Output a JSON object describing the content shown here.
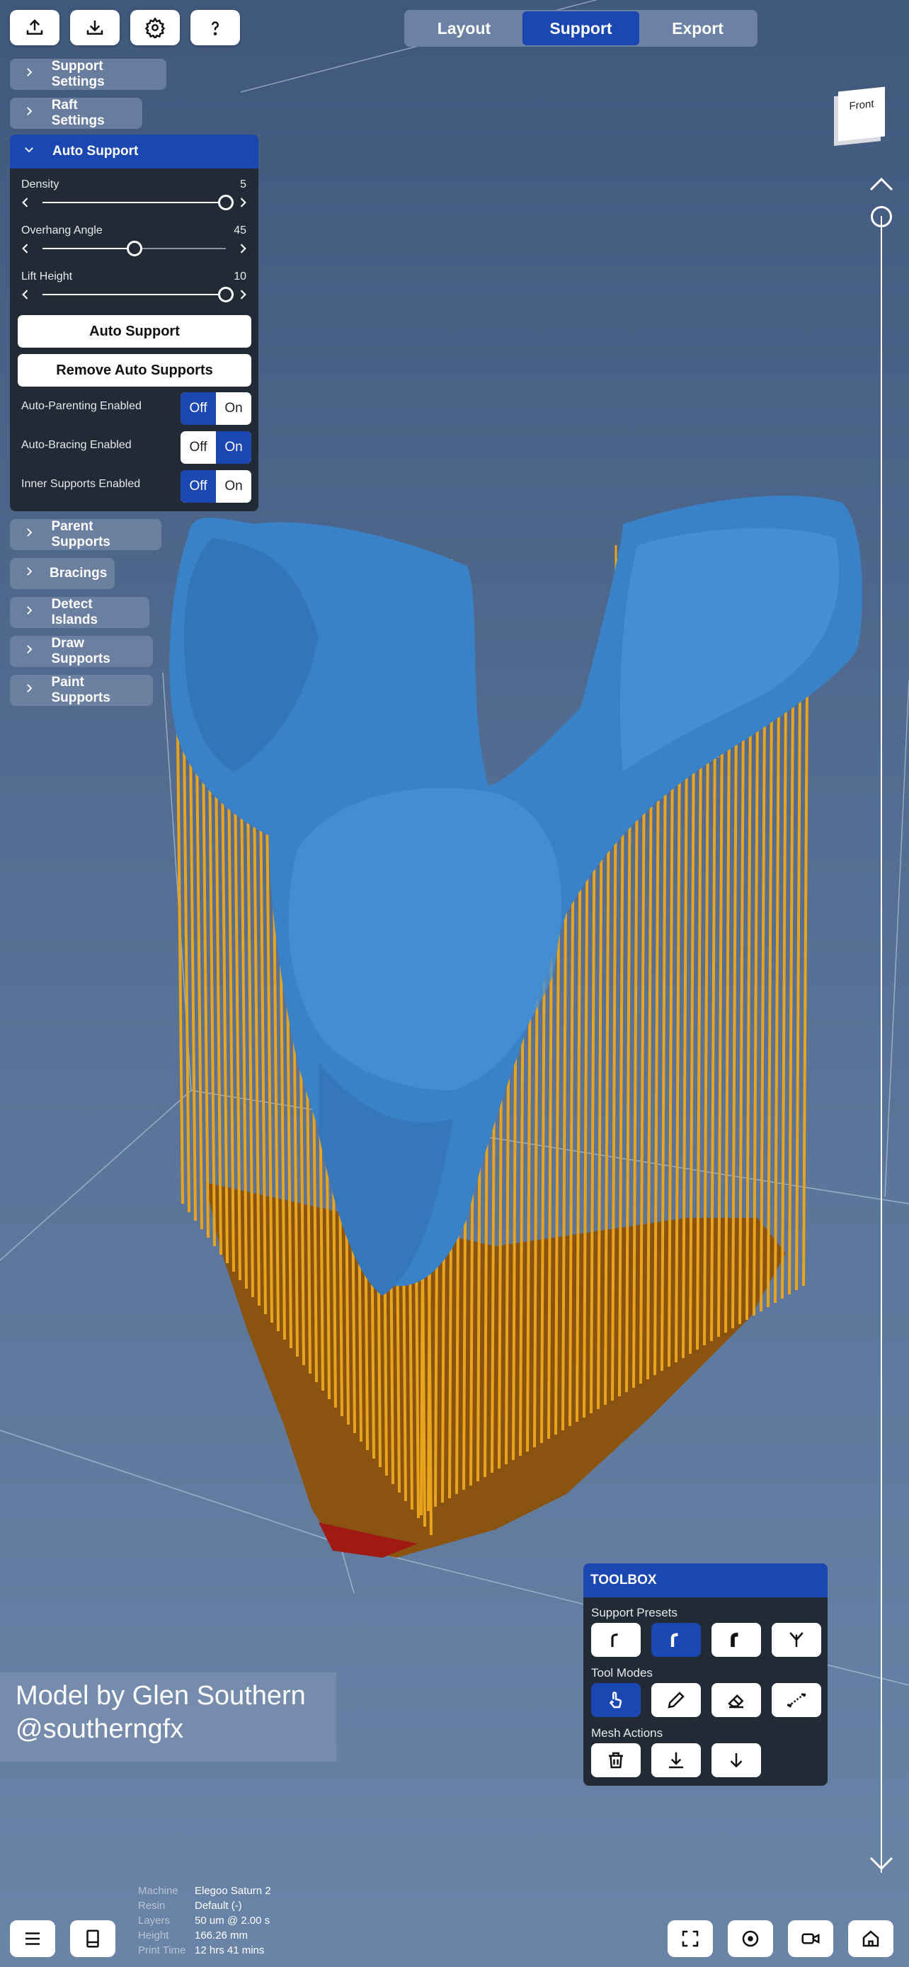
{
  "tabs": [
    {
      "label": "Layout",
      "active": false
    },
    {
      "label": "Support",
      "active": true
    },
    {
      "label": "Export",
      "active": false
    }
  ],
  "toolbar_icons": [
    "upload-icon",
    "download-icon",
    "settings-icon",
    "help-icon"
  ],
  "sections_top": [
    {
      "label": "Support Settings"
    },
    {
      "label": "Raft Settings"
    }
  ],
  "auto_support": {
    "title": "Auto Support",
    "sliders": [
      {
        "label": "Density",
        "value": "5",
        "fraction": 1.0
      },
      {
        "label": "Overhang Angle",
        "value": "45",
        "fraction": 0.5
      },
      {
        "label": "Lift Height",
        "value": "10",
        "fraction": 1.0
      }
    ],
    "auto_support_button": "Auto Support",
    "remove_button": "Remove Auto Supports",
    "toggles": [
      {
        "label": "Auto-Parenting Enabled",
        "off": "Off",
        "on": "On",
        "state": "Off"
      },
      {
        "label": "Auto-Bracing Enabled",
        "off": "Off",
        "on": "On",
        "state": "On"
      },
      {
        "label": "Inner Supports Enabled",
        "off": "Off",
        "on": "On",
        "state": "Off"
      }
    ]
  },
  "sections_bottom": [
    {
      "label": "Parent Supports"
    },
    {
      "label": "Bracings"
    },
    {
      "label": "Detect Islands"
    },
    {
      "label": "Draw Supports"
    },
    {
      "label": "Paint Supports"
    }
  ],
  "view_cube": {
    "label": "Front"
  },
  "toolbox": {
    "title": "TOOLBOX",
    "support_presets_label": "Support Presets",
    "tool_modes_label": "Tool Modes",
    "mesh_actions_label": "Mesh Actions",
    "presets": [
      "preset-light-icon",
      "preset-medium-icon",
      "preset-heavy-icon",
      "preset-branch-icon"
    ],
    "presets_active": 1,
    "modes": [
      "touch-icon",
      "pencil-icon",
      "eraser-icon",
      "line-icon"
    ],
    "modes_active": 0,
    "mesh": [
      "trash-icon",
      "drop-to-plate-icon",
      "move-down-icon"
    ]
  },
  "credit": {
    "line1": "Model by Glen Southern",
    "line2": "@southerngfx"
  },
  "print_info": [
    {
      "key": "Machine",
      "value": "Elegoo Saturn 2"
    },
    {
      "key": "Resin",
      "value": "Default (-)"
    },
    {
      "key": "Layers",
      "value": "50 um @ 2.00 s"
    },
    {
      "key": "Height",
      "value": "166.26 mm"
    },
    {
      "key": "Print Time",
      "value": "12 hrs 41 mins"
    }
  ],
  "colors": {
    "accent": "#1b47b3",
    "model": "#3a82c8",
    "supports": "#e8a51c",
    "raft": "#8a5410",
    "background": "#5a7398"
  }
}
